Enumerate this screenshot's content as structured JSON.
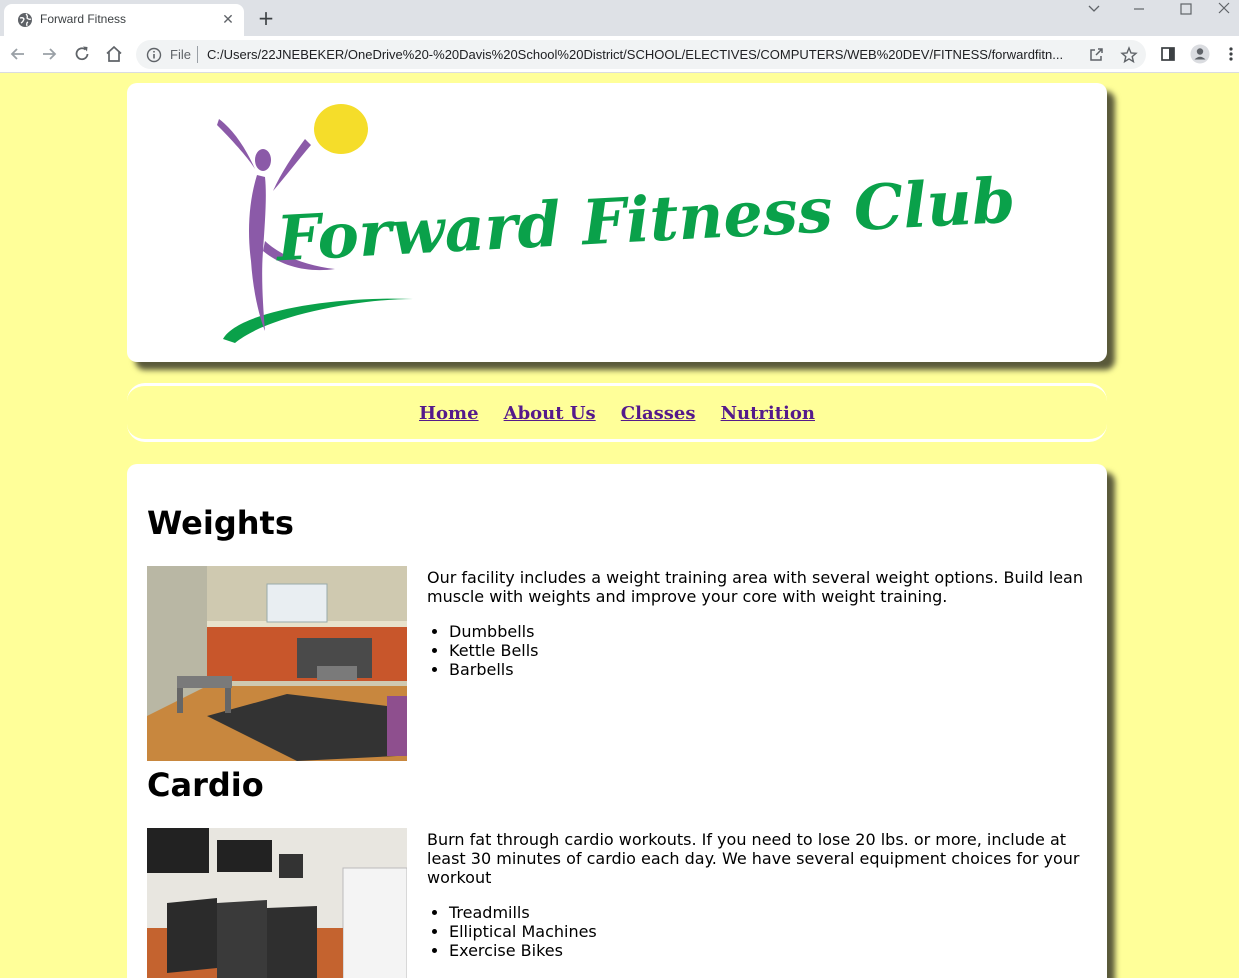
{
  "browser": {
    "tab_title": "Forward Fitness",
    "tab_close": "✕",
    "new_tab": "+",
    "scheme": "File",
    "url": "C:/Users/22JNEBEKER/OneDrive%20-%20Davis%20School%20District/SCHOOL/ELECTIVES/COMPUTERS/WEB%20DEV/FITNESS/forwardfitn...",
    "icons": [
      "globe-icon",
      "close-icon",
      "plus-icon",
      "back-icon",
      "forward-icon",
      "reload-icon",
      "home-icon",
      "info-icon",
      "share-icon",
      "star-icon",
      "sidepanel-icon",
      "profile-icon",
      "menu-icon",
      "chevron-down-icon",
      "minimize-icon",
      "maximize-icon",
      "window-close-icon"
    ]
  },
  "header": {
    "logo_text": "Forward Fitness Club"
  },
  "nav": {
    "items": [
      "Home",
      "About Us",
      "Classes",
      "Nutrition"
    ]
  },
  "sections": [
    {
      "title": "Weights",
      "description": "Our facility includes a weight training area with several weight options. Build lean muscle with weights and improve your core with weight training.",
      "items": [
        "Dumbbells",
        "Kettle Bells",
        "Barbells"
      ]
    },
    {
      "title": "Cardio",
      "description": "Burn fat through cardio workouts. If you need to lose 20 lbs. or more, include at least 30 minutes of cardio each day. We have several equipment choices for your workout",
      "items": [
        "Treadmills",
        "Elliptical Machines",
        "Exercise Bikes"
      ]
    }
  ],
  "colors": {
    "page_bg": "#ffff99",
    "logo_green": "#0aa14a",
    "logo_purple": "#8b5aa8",
    "logo_sun": "#f5dd2a",
    "link": "#551a8b"
  }
}
